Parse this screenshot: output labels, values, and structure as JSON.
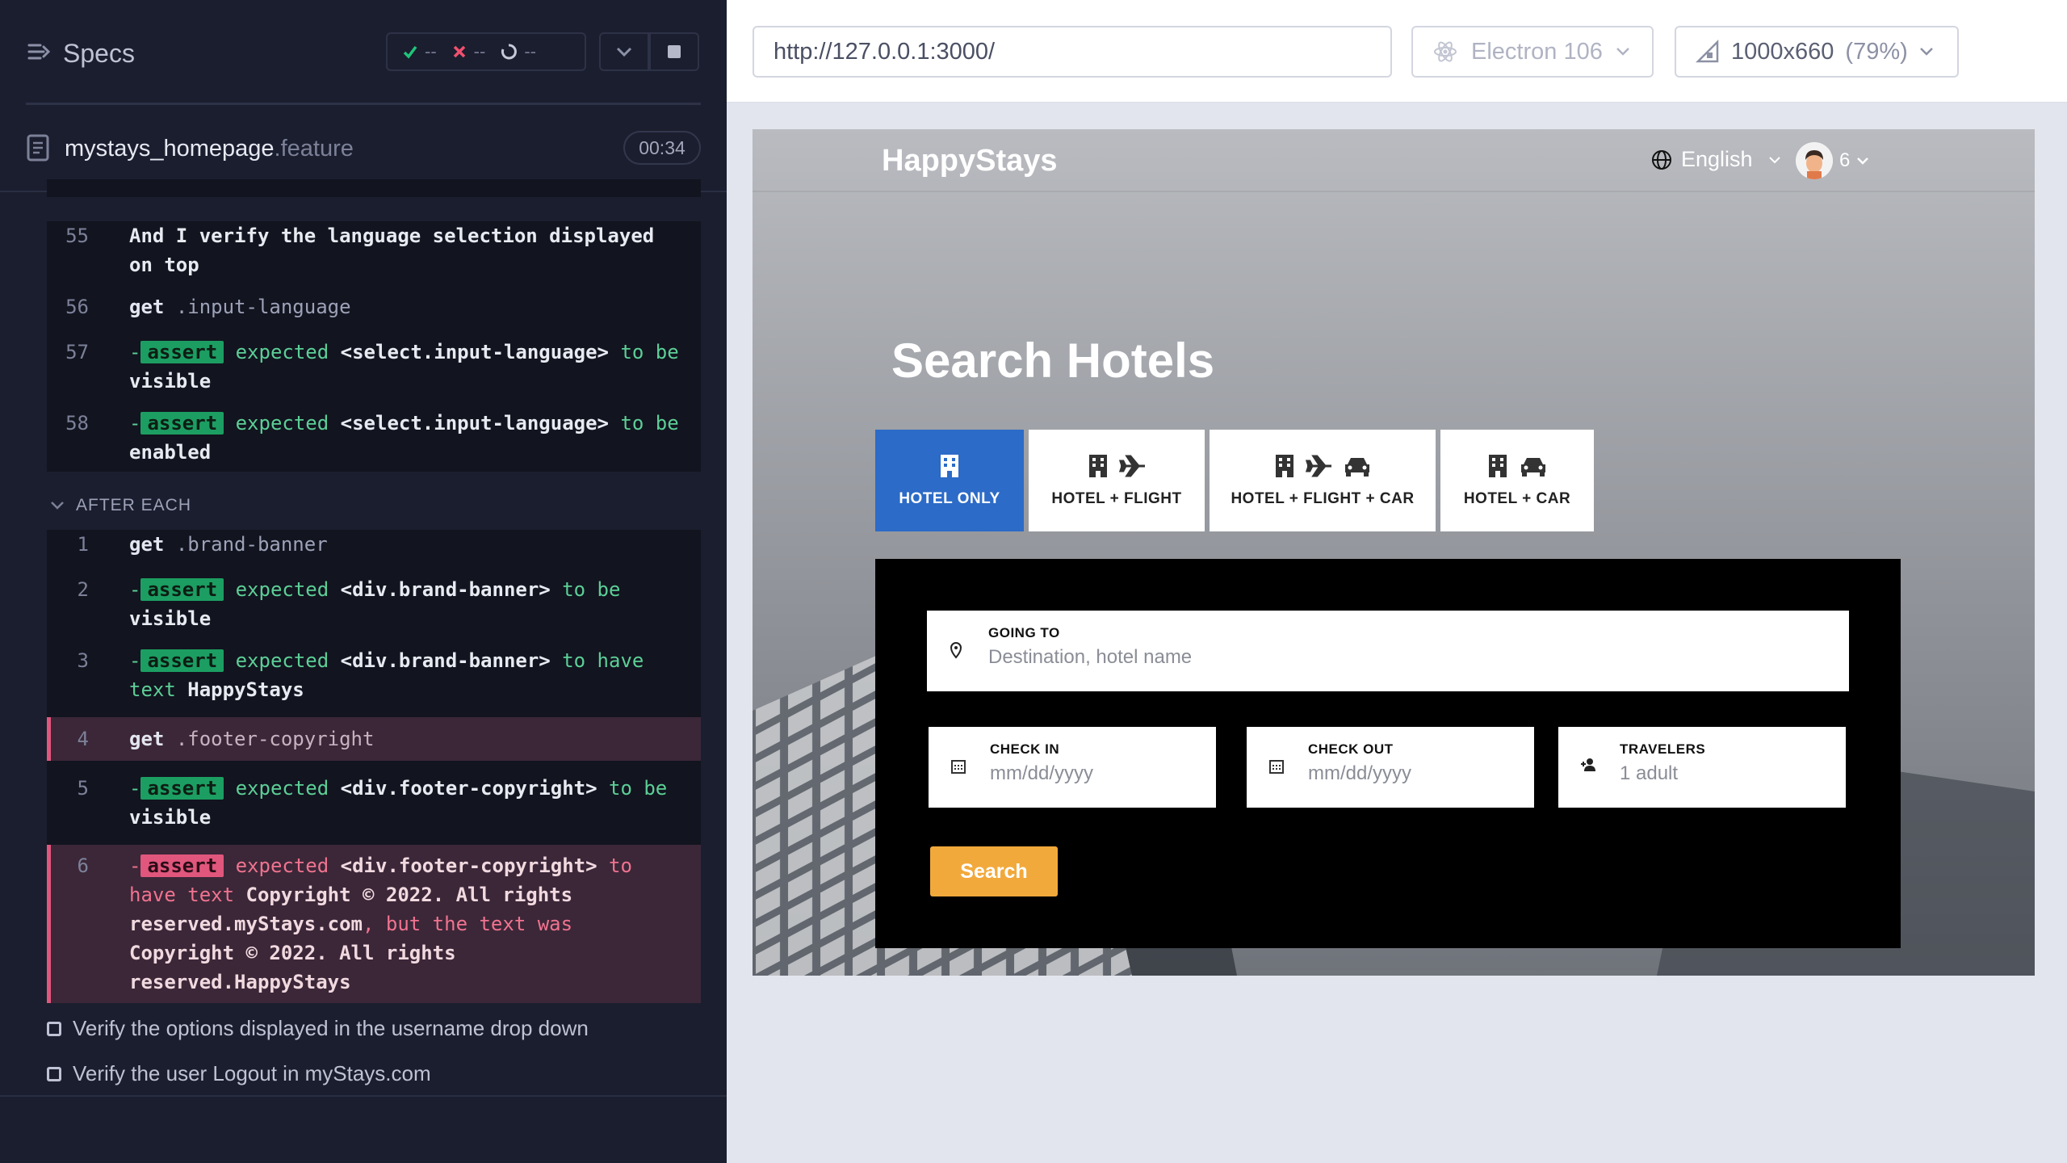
{
  "reporter": {
    "title": "Specs",
    "stats": {
      "passed": "--",
      "failed": "--",
      "pending": "--"
    },
    "spec_file": {
      "name": "mystays_homepage",
      "ext": ".feature",
      "duration": "00:34"
    },
    "commands": [
      {
        "ln": "55",
        "text": "And  I verify the language selection displayed on top"
      },
      {
        "ln": "56",
        "name": "get",
        "selector": ".input-language"
      },
      {
        "ln": "57",
        "badge": "assert",
        "pre": "expected",
        "el": "<select.input-language>",
        "mid": "to be",
        "val": "visible"
      },
      {
        "ln": "58",
        "badge": "assert",
        "pre": "expected",
        "el": "<select.input-language>",
        "mid": "to be",
        "val": "enabled"
      }
    ],
    "after_each_label": "AFTER EACH",
    "after_each": [
      {
        "ln": "1",
        "name": "get",
        "selector": ".brand-banner"
      },
      {
        "ln": "2",
        "badge": "assert",
        "pre": "expected",
        "el": "<div.brand-banner>",
        "mid": "to be",
        "val": "visible"
      },
      {
        "ln": "3",
        "badge": "assert",
        "pre": "expected",
        "el": "<div.brand-banner>",
        "mid": "to have text",
        "val": "HappyStays"
      },
      {
        "ln": "4",
        "name": "get",
        "selector": ".footer-copyright"
      },
      {
        "ln": "5",
        "badge": "assert",
        "pre": "expected",
        "el": "<div.footer-copyright>",
        "mid": "to be",
        "val": "visible"
      },
      {
        "ln": "6",
        "badge": "assert",
        "pre": "expected",
        "el": "<div.footer-copyright>",
        "mid": "to have text",
        "val": "Copyright © 2022. All rights reserved.myStays.com",
        "mid2": ", but the text was",
        "val2": "Copyright © 2022. All rights reserved.HappyStays"
      }
    ],
    "tests": [
      "Verify the options displayed in the username drop down",
      "Verify the user Logout in myStays.com"
    ]
  },
  "aut": {
    "url": "http://127.0.0.1:3000/",
    "browser": "Electron 106",
    "viewport": "1000x660",
    "scale": "(79%)"
  },
  "app": {
    "brand": "HappyStays",
    "language": "English",
    "user_initial": "6",
    "hero_title": "Search Hotels",
    "tabs": [
      "HOTEL ONLY",
      "HOTEL + FLIGHT",
      "HOTEL + FLIGHT + CAR",
      "HOTEL + CAR"
    ],
    "going_to": {
      "label": "GOING TO",
      "placeholder": "Destination, hotel name"
    },
    "check_in": {
      "label": "CHECK IN",
      "placeholder": "mm/dd/yyyy"
    },
    "check_out": {
      "label": "CHECK OUT",
      "placeholder": "mm/dd/yyyy"
    },
    "travelers": {
      "label": "TRAVELERS",
      "value": "1 adult"
    },
    "search_label": "Search"
  },
  "colors": {
    "reporter_bg": "#1b1e2e",
    "pass_green": "#1c9e62",
    "fail_red": "#e0567c",
    "tab_active": "#2c6bc7",
    "search_button": "#f2a93b"
  }
}
